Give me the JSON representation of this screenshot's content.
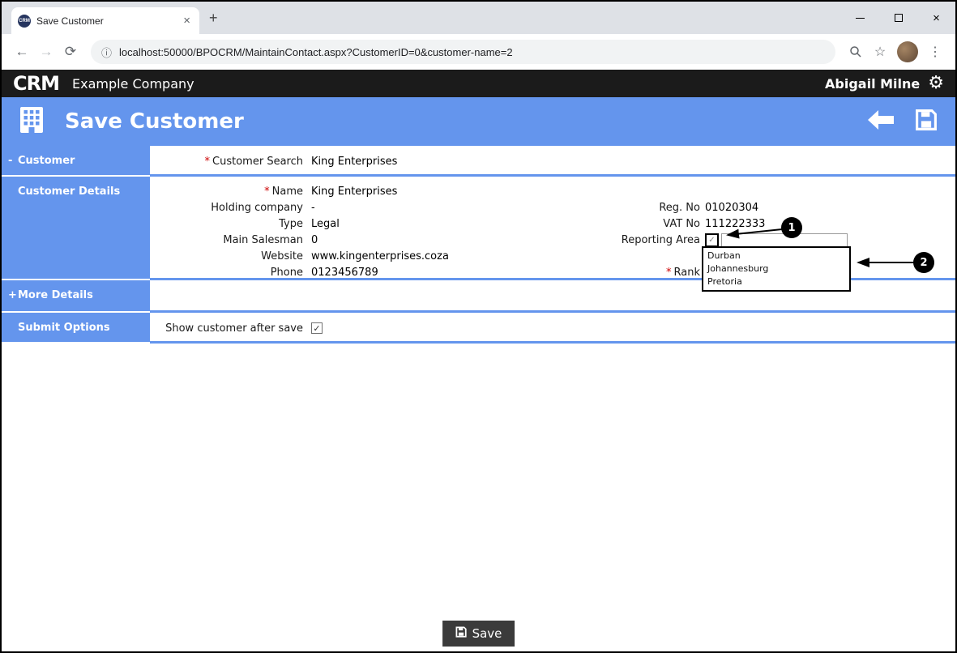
{
  "icons": {
    "tab_close": "×",
    "new_tab": "+",
    "window_close": "×",
    "back": "←",
    "forward": "→",
    "reload": "⟳",
    "info": "ⓘ",
    "star": "☆",
    "menu_dots": "⋮",
    "gear": "⚙",
    "check": "✓"
  },
  "ui": {
    "required_marker": "*"
  },
  "browser": {
    "tab_title": "Save Customer",
    "favicon_text": "CRM",
    "url": "localhost:50000/BPOCRM/MaintainContact.aspx?CustomerID=0&customer-name=2"
  },
  "app_header": {
    "logo": "CRM",
    "company": "Example Company",
    "user": "Abigail Milne"
  },
  "page_header": {
    "title": "Save Customer"
  },
  "sections": {
    "customer": {
      "toggle": "-",
      "title": "Customer",
      "field": {
        "label": "Customer Search",
        "value": "King Enterprises",
        "required": true
      }
    },
    "customer_details": {
      "title": "Customer Details",
      "left": [
        {
          "label": "Name",
          "value": "King Enterprises",
          "required": true
        },
        {
          "label": "Holding company",
          "value": "-"
        },
        {
          "label": "Type",
          "value": "Legal"
        },
        {
          "label": "Main Salesman",
          "value": "0"
        },
        {
          "label": "Website",
          "value": "www.kingenterprises.coza"
        },
        {
          "label": "Phone",
          "value": "0123456789"
        }
      ],
      "right": [
        {
          "label": "Reg. No",
          "value": "01020304"
        },
        {
          "label": "VAT No",
          "value": "111222333"
        },
        {
          "label": "Reporting Area",
          "value": ""
        },
        {
          "label": "Rank",
          "required": true
        }
      ],
      "dropdown": {
        "value": "",
        "options": [
          "Durban",
          "Johannesburg",
          "Pretoria"
        ]
      }
    },
    "more_details": {
      "toggle": "+",
      "title": "More Details"
    },
    "submit_options": {
      "title": "Submit Options",
      "field_label": "Show customer after save",
      "checked": true
    }
  },
  "annotations": {
    "step1": "1",
    "step2": "2"
  },
  "footer": {
    "save_label": "Save"
  },
  "colors": {
    "accent_blue": "#6495ED",
    "dark_bar": "#1b1b1b",
    "required_red": "#cc0000",
    "save_button": "#3b3b3b"
  }
}
